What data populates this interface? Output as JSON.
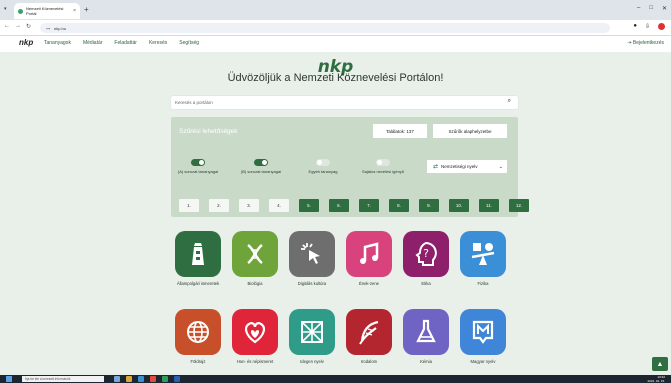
{
  "browser": {
    "tab_title": "Nemzeti Köznevelési Portál",
    "url": "nkp.hu",
    "new_tab_symbol": "+"
  },
  "header": {
    "logo": "nkp",
    "nav": [
      "Tananyagok",
      "Médiatár",
      "Feladattár",
      "Keresés",
      "Segítség"
    ],
    "login": "Bejelentkezés"
  },
  "hero": {
    "brand": "nkp",
    "welcome": "Üdvözöljük a Nemzeti Köznevelési Portálon!"
  },
  "search": {
    "placeholder": "Keresés a portálon"
  },
  "filter": {
    "title": "Szűrési lehetőségek",
    "count_label": "Találatok: 137",
    "reset_label": "Szűrők alaphelyzetbe",
    "toggles": [
      {
        "label": "(A) sorozat tananyagai",
        "on": true
      },
      {
        "label": "(B) sorozat tananyagai",
        "on": true
      },
      {
        "label": "Egyéb tananyag",
        "on": false
      },
      {
        "label": "Sajátos nevelési igényű",
        "on": false
      }
    ],
    "language_select": "Nemzetiségi nyelv",
    "grades": [
      "1.",
      "2.",
      "3.",
      "4.",
      "5.",
      "6.",
      "7.",
      "8.",
      "9.",
      "10.",
      "11.",
      "12."
    ],
    "grades_active_from": 5
  },
  "subjects": [
    {
      "name": "Állampolgári ismeretek",
      "icon": "lighthouse-icon",
      "color": "#2f6e40"
    },
    {
      "name": "Biológia",
      "icon": "dna-icon",
      "color": "#6fa43a"
    },
    {
      "name": "Digitális kultúra",
      "icon": "cursor-click-icon",
      "color": "#6e6e6e"
    },
    {
      "name": "Ének-zene",
      "icon": "music-note-icon",
      "color": "#d9437d"
    },
    {
      "name": "Etika",
      "icon": "question-head-icon",
      "color": "#8e1f6b"
    },
    {
      "name": "Fizika",
      "icon": "shapes-balance-icon",
      "color": "#3a8fd6"
    },
    {
      "name": "Földrajz",
      "icon": "globe-icon",
      "color": "#c7502a"
    },
    {
      "name": "Hon- és népismeret",
      "icon": "folk-motif-icon",
      "color": "#e0243a"
    },
    {
      "name": "Idegen nyelv",
      "icon": "flag-icon",
      "color": "#2f9c8a"
    },
    {
      "name": "Irodalom",
      "icon": "quill-icon",
      "color": "#b3262f"
    },
    {
      "name": "Kémia",
      "icon": "flask-icon",
      "color": "#6f64c4"
    },
    {
      "name": "Magyar nyelv",
      "icon": "speech-m-icon",
      "color": "#3f86d8"
    }
  ],
  "taskbar": {
    "search_placeholder": "Írja be ide a keresett információt",
    "clock_time": "10:32",
    "clock_date": "2024. 01. 15."
  },
  "colors": {
    "accent": "#2f6e40",
    "background": "#e9efe9",
    "panel": "#c9dac9"
  }
}
